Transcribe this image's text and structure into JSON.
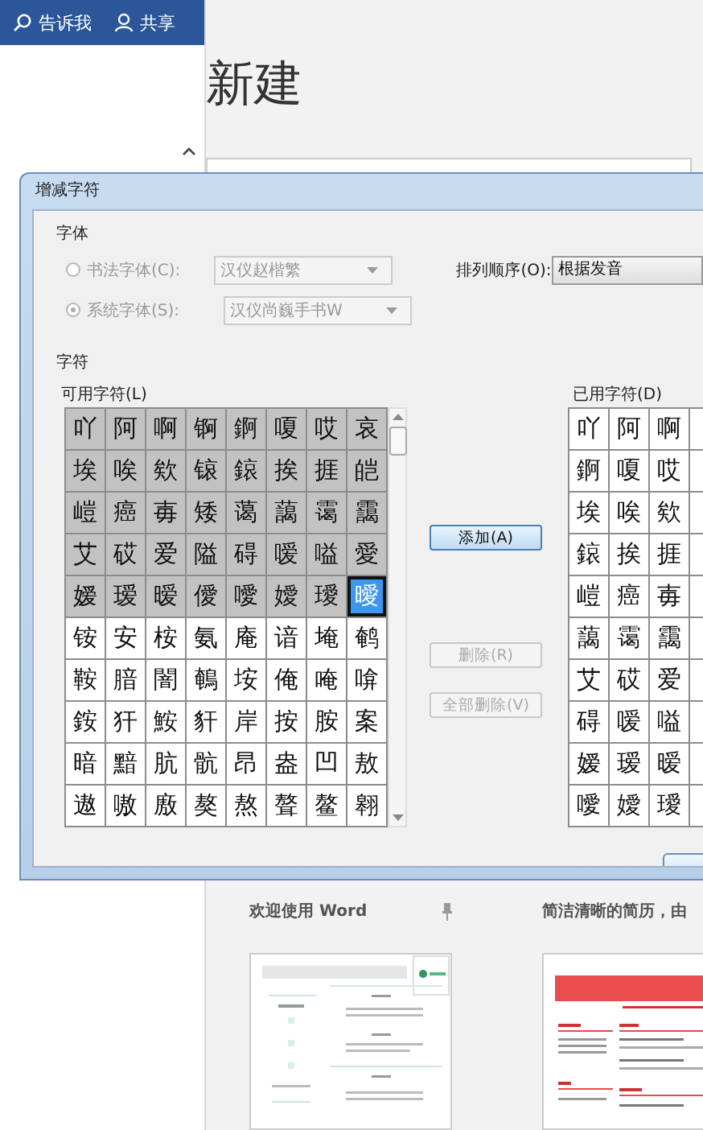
{
  "ribbon": {
    "items": [
      {
        "kind": "search",
        "label": "告诉我"
      },
      {
        "kind": "share",
        "label": "共享"
      }
    ]
  },
  "page_title": "新建",
  "templates": [
    {
      "kind": "resume-green",
      "title": "欢迎使用 Word",
      "pinned": true
    },
    {
      "kind": "resume-red",
      "title": "简洁清晰的简历，由",
      "pinned": false
    }
  ],
  "dialog": {
    "title": "增减字符",
    "font_group": {
      "label": "字体",
      "options": [
        {
          "label": "书法字体(C):",
          "selected": false,
          "disabled": true,
          "font": "汉仪赵楷繁"
        },
        {
          "label": "系统字体(S):",
          "selected": true,
          "disabled": true,
          "font": "汉仪尚巍手书W"
        }
      ]
    },
    "sort": {
      "label": "排列顺序(O):",
      "value": "根据发音"
    },
    "chars_group": {
      "label": "字符",
      "available": {
        "label": "可用字符(L)",
        "rows": [
          [
            {
              "c": "吖",
              "used": true,
              "selected": false
            },
            {
              "c": "阿",
              "used": true,
              "selected": false
            },
            {
              "c": "啊",
              "used": true,
              "selected": false
            },
            {
              "c": "锕",
              "used": true,
              "selected": false
            },
            {
              "c": "錒",
              "used": true,
              "selected": false
            },
            {
              "c": "嗄",
              "used": true,
              "selected": false
            },
            {
              "c": "哎",
              "used": true,
              "selected": false
            },
            {
              "c": "哀",
              "used": true,
              "selected": false
            }
          ],
          [
            {
              "c": "埃",
              "used": true,
              "selected": false
            },
            {
              "c": "唉",
              "used": true,
              "selected": false
            },
            {
              "c": "欸",
              "used": true,
              "selected": false
            },
            {
              "c": "锿",
              "used": true,
              "selected": false
            },
            {
              "c": "鎄",
              "used": true,
              "selected": false
            },
            {
              "c": "挨",
              "used": true,
              "selected": false
            },
            {
              "c": "捱",
              "used": true,
              "selected": false
            },
            {
              "c": "皑",
              "used": true,
              "selected": false
            }
          ],
          [
            {
              "c": "嵦",
              "used": true,
              "selected": false
            },
            {
              "c": "癌",
              "used": true,
              "selected": false
            },
            {
              "c": "毐",
              "used": true,
              "selected": false
            },
            {
              "c": "矮",
              "used": true,
              "selected": false
            },
            {
              "c": "蔼",
              "used": true,
              "selected": false
            },
            {
              "c": "藹",
              "used": true,
              "selected": false
            },
            {
              "c": "霭",
              "used": true,
              "selected": false
            },
            {
              "c": "靄",
              "used": true,
              "selected": false
            }
          ],
          [
            {
              "c": "艾",
              "used": true,
              "selected": false
            },
            {
              "c": "砹",
              "used": true,
              "selected": false
            },
            {
              "c": "爱",
              "used": true,
              "selected": false
            },
            {
              "c": "隘",
              "used": true,
              "selected": false
            },
            {
              "c": "碍",
              "used": true,
              "selected": false
            },
            {
              "c": "嗳",
              "used": true,
              "selected": false
            },
            {
              "c": "嗌",
              "used": true,
              "selected": false
            },
            {
              "c": "愛",
              "used": true,
              "selected": false
            }
          ],
          [
            {
              "c": "嫒",
              "used": true,
              "selected": false
            },
            {
              "c": "瑷",
              "used": true,
              "selected": false
            },
            {
              "c": "暧",
              "used": true,
              "selected": false
            },
            {
              "c": "僾",
              "used": true,
              "selected": false
            },
            {
              "c": "噯",
              "used": true,
              "selected": false
            },
            {
              "c": "嬡",
              "used": true,
              "selected": false
            },
            {
              "c": "璦",
              "used": true,
              "selected": false
            },
            {
              "c": "曖",
              "used": true,
              "selected": true
            }
          ],
          [
            {
              "c": "铵",
              "used": false,
              "selected": false
            },
            {
              "c": "安",
              "used": false,
              "selected": false
            },
            {
              "c": "桉",
              "used": false,
              "selected": false
            },
            {
              "c": "氨",
              "used": false,
              "selected": false
            },
            {
              "c": "庵",
              "used": false,
              "selected": false
            },
            {
              "c": "谙",
              "used": false,
              "selected": false
            },
            {
              "c": "埯",
              "used": false,
              "selected": false
            },
            {
              "c": "鹌",
              "used": false,
              "selected": false
            }
          ],
          [
            {
              "c": "鞍",
              "used": false,
              "selected": false
            },
            {
              "c": "腤",
              "used": false,
              "selected": false
            },
            {
              "c": "闇",
              "used": false,
              "selected": false
            },
            {
              "c": "鵪",
              "used": false,
              "selected": false
            },
            {
              "c": "垵",
              "used": false,
              "selected": false
            },
            {
              "c": "俺",
              "used": false,
              "selected": false
            },
            {
              "c": "唵",
              "used": false,
              "selected": false
            },
            {
              "c": "啽",
              "used": false,
              "selected": false
            }
          ],
          [
            {
              "c": "銨",
              "used": false,
              "selected": false
            },
            {
              "c": "犴",
              "used": false,
              "selected": false
            },
            {
              "c": "鮟",
              "used": false,
              "selected": false
            },
            {
              "c": "豻",
              "used": false,
              "selected": false
            },
            {
              "c": "岸",
              "used": false,
              "selected": false
            },
            {
              "c": "按",
              "used": false,
              "selected": false
            },
            {
              "c": "胺",
              "used": false,
              "selected": false
            },
            {
              "c": "案",
              "used": false,
              "selected": false
            }
          ],
          [
            {
              "c": "暗",
              "used": false,
              "selected": false
            },
            {
              "c": "黯",
              "used": false,
              "selected": false
            },
            {
              "c": "肮",
              "used": false,
              "selected": false
            },
            {
              "c": "骯",
              "used": false,
              "selected": false
            },
            {
              "c": "昂",
              "used": false,
              "selected": false
            },
            {
              "c": "盎",
              "used": false,
              "selected": false
            },
            {
              "c": "凹",
              "used": false,
              "selected": false
            },
            {
              "c": "敖",
              "used": false,
              "selected": false
            }
          ],
          [
            {
              "c": "遨",
              "used": false,
              "selected": false
            },
            {
              "c": "嗷",
              "used": false,
              "selected": false
            },
            {
              "c": "廒",
              "used": false,
              "selected": false
            },
            {
              "c": "獒",
              "used": false,
              "selected": false
            },
            {
              "c": "熬",
              "used": false,
              "selected": false
            },
            {
              "c": "聱",
              "used": false,
              "selected": false
            },
            {
              "c": "鳌",
              "used": false,
              "selected": false
            },
            {
              "c": "翱",
              "used": false,
              "selected": false
            }
          ]
        ]
      },
      "buttons": [
        {
          "label": "添加(A)",
          "disabled": false
        },
        {
          "label": "删除(R)",
          "disabled": true
        },
        {
          "label": "全部删除(V)",
          "disabled": true
        }
      ],
      "used": {
        "label": "已用字符(D)",
        "rows": [
          [
            "吖",
            "阿",
            "啊"
          ],
          [
            "錒",
            "嗄",
            "哎"
          ],
          [
            "埃",
            "唉",
            "欸"
          ],
          [
            "鎄",
            "挨",
            "捱"
          ],
          [
            "嵦",
            "癌",
            "毐"
          ],
          [
            "藹",
            "霭",
            "靄"
          ],
          [
            "艾",
            "砹",
            "爱"
          ],
          [
            "碍",
            "嗳",
            "嗌"
          ],
          [
            "嫒",
            "瑷",
            "暧"
          ],
          [
            "噯",
            "嬡",
            "璦"
          ]
        ]
      }
    }
  }
}
